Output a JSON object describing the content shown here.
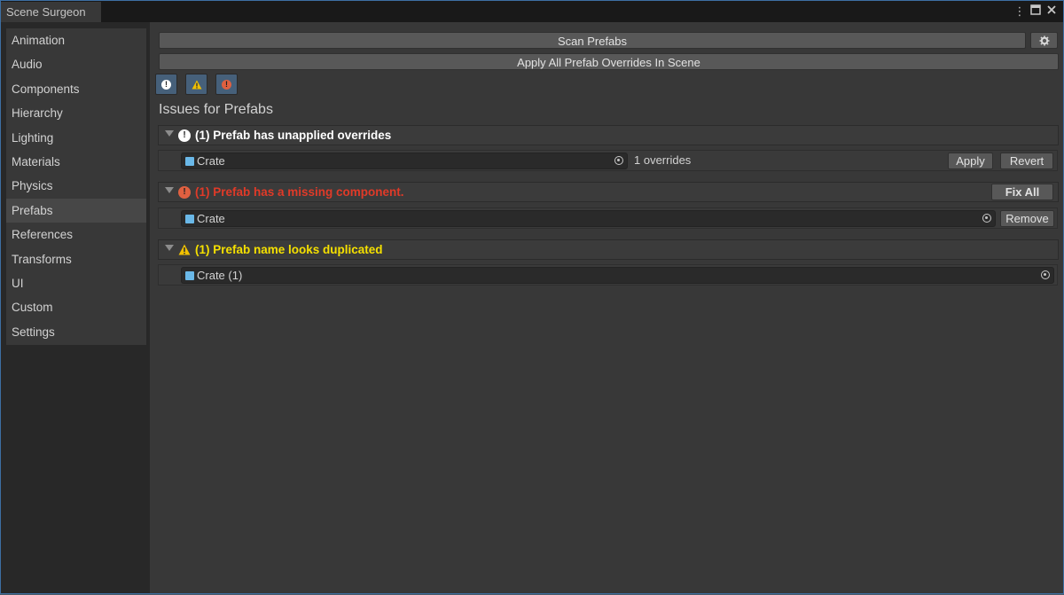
{
  "window": {
    "title": "Scene Surgeon"
  },
  "titlebar": {
    "more_icon": "kebab-menu-icon",
    "maximize_icon": "maximize-icon",
    "close_icon": "close-icon"
  },
  "sidebar": {
    "items": [
      {
        "label": "Animation"
      },
      {
        "label": "Audio"
      },
      {
        "label": "Components"
      },
      {
        "label": "Hierarchy"
      },
      {
        "label": "Lighting"
      },
      {
        "label": "Materials"
      },
      {
        "label": "Physics"
      },
      {
        "label": "Prefabs",
        "active": true
      },
      {
        "label": "References"
      },
      {
        "label": "Transforms"
      },
      {
        "label": "UI"
      },
      {
        "label": "Custom"
      },
      {
        "label": "Settings"
      }
    ]
  },
  "toolbar": {
    "scan_label": "Scan Prefabs",
    "settings_icon": "gear-icon",
    "apply_all_label": "Apply All Prefab Overrides In Scene",
    "filters": [
      {
        "icon": "info-filter-icon",
        "color": "#ffffff"
      },
      {
        "icon": "warning-filter-icon",
        "color": "#f0c000"
      },
      {
        "icon": "error-filter-icon",
        "color": "#e06040"
      }
    ]
  },
  "main": {
    "heading": "Issues for Prefabs",
    "groups": [
      {
        "title": "(1) Prefab has unapplied overrides",
        "color": "#ffffff",
        "icon": "info-icon",
        "rows": [
          {
            "object": "Crate",
            "extra": "1 overrides",
            "apply_label": "Apply",
            "revert_label": "Revert"
          }
        ]
      },
      {
        "title": "(1) Prefab has a missing component.",
        "color": "#e03a28",
        "icon": "error-icon",
        "fix_all_label": "Fix All",
        "rows": [
          {
            "object": "Crate",
            "remove_label": "Remove"
          }
        ]
      },
      {
        "title": "(1) Prefab name looks duplicated",
        "color": "#f5e000",
        "icon": "warning-icon",
        "rows": [
          {
            "object": "Crate (1)"
          }
        ]
      }
    ]
  }
}
